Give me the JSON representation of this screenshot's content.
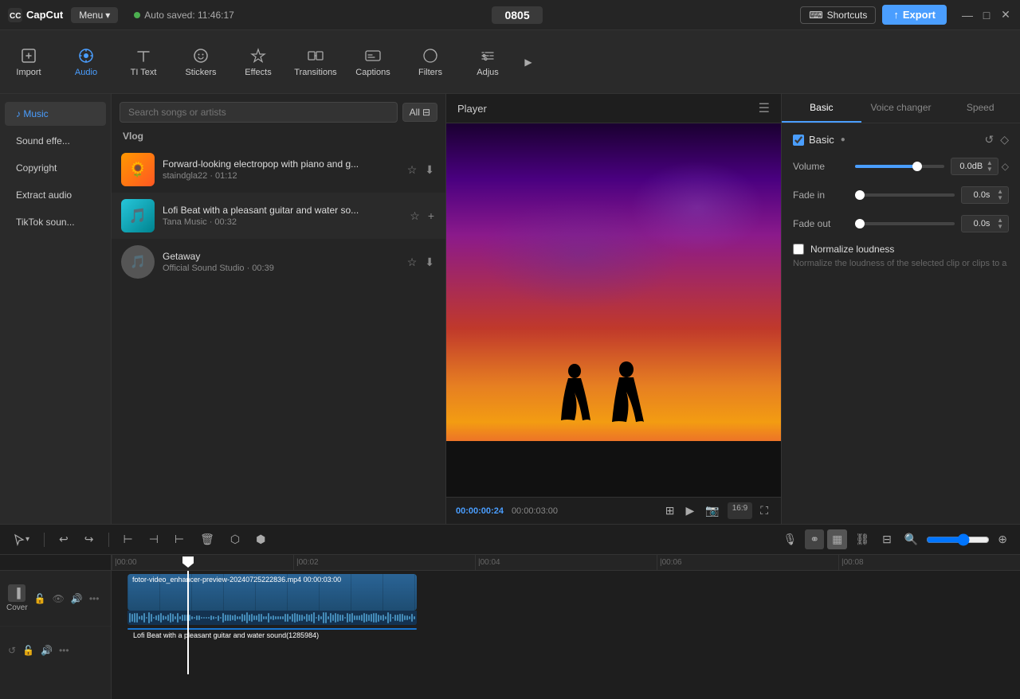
{
  "topbar": {
    "app_name": "CapCut",
    "menu_label": "Menu",
    "autosave_text": "Auto saved: 11:46:17",
    "timecode": "0805",
    "shortcuts_label": "Shortcuts",
    "export_label": "Export"
  },
  "toolbar": {
    "items": [
      {
        "id": "import",
        "label": "Import",
        "icon": "import"
      },
      {
        "id": "audio",
        "label": "Audio",
        "icon": "audio",
        "active": true
      },
      {
        "id": "text",
        "label": "Text",
        "icon": "text"
      },
      {
        "id": "stickers",
        "label": "Stickers",
        "icon": "stickers"
      },
      {
        "id": "effects",
        "label": "Effects",
        "icon": "effects"
      },
      {
        "id": "transitions",
        "label": "Transitions",
        "icon": "transitions"
      },
      {
        "id": "captions",
        "label": "Captions",
        "icon": "captions"
      },
      {
        "id": "filters",
        "label": "Filters",
        "icon": "filters"
      },
      {
        "id": "adjust",
        "label": "Adjust",
        "icon": "adjust"
      }
    ]
  },
  "left_panel": {
    "items": [
      {
        "id": "music",
        "label": "♪ Music",
        "active": true
      },
      {
        "id": "sound_effects",
        "label": "Sound effe..."
      },
      {
        "id": "copyright",
        "label": "Copyright"
      },
      {
        "id": "extract_audio",
        "label": "Extract audio"
      },
      {
        "id": "tiktok",
        "label": "TikTok soun..."
      }
    ]
  },
  "music_panel": {
    "search_placeholder": "Search songs or artists",
    "all_label": "All",
    "section_label": "Vlog",
    "songs": [
      {
        "id": 1,
        "title": "Forward-looking electropop with piano and g...",
        "meta": "staindgla22 · 01:12",
        "thumb_type": "orange",
        "downloaded": true
      },
      {
        "id": 2,
        "title": "Lofi Beat with a pleasant guitar and water so...",
        "meta": "Tana Music · 00:32",
        "thumb_type": "teal",
        "downloaded": false
      },
      {
        "id": 3,
        "title": "Getaway",
        "meta": "Official Sound Studio · 00:39",
        "thumb_type": "gray",
        "downloaded": true
      }
    ]
  },
  "player": {
    "title": "Player",
    "time_current": "00:00:00:24",
    "time_total": "00:00:03:00",
    "aspect_ratio": "16:9"
  },
  "right_panel": {
    "tabs": [
      {
        "id": "basic",
        "label": "Basic",
        "active": true
      },
      {
        "id": "voice_changer",
        "label": "Voice changer"
      },
      {
        "id": "speed",
        "label": "Speed"
      }
    ],
    "basic": {
      "label": "Basic",
      "volume": {
        "label": "Volume",
        "value": "0.0dB",
        "fill_pct": 70
      },
      "fade_in": {
        "label": "Fade in",
        "value": "0.0s",
        "fill_pct": 0
      },
      "fade_out": {
        "label": "Fade out",
        "value": "0.0s",
        "fill_pct": 0
      },
      "normalize": {
        "label": "Normalize loudness",
        "desc": "Normalize the loudness of the selected clip or clips to a"
      }
    }
  },
  "timeline": {
    "ruler_marks": [
      "00:00",
      "00:02",
      "00:04",
      "00:06",
      "00:08"
    ],
    "video_clip": {
      "label": "fotor-video_enhancer-preview-20240725222836.mp4  00:00:03:00"
    },
    "audio_clip": {
      "label": "Lofi Beat with a pleasant guitar and water sound(1285984)"
    },
    "cover_label": "Cover"
  },
  "colors": {
    "accent": "#4a9eff",
    "bg_dark": "#1a1a1a",
    "bg_panel": "#252525",
    "bg_track": "#2a2a2a"
  }
}
